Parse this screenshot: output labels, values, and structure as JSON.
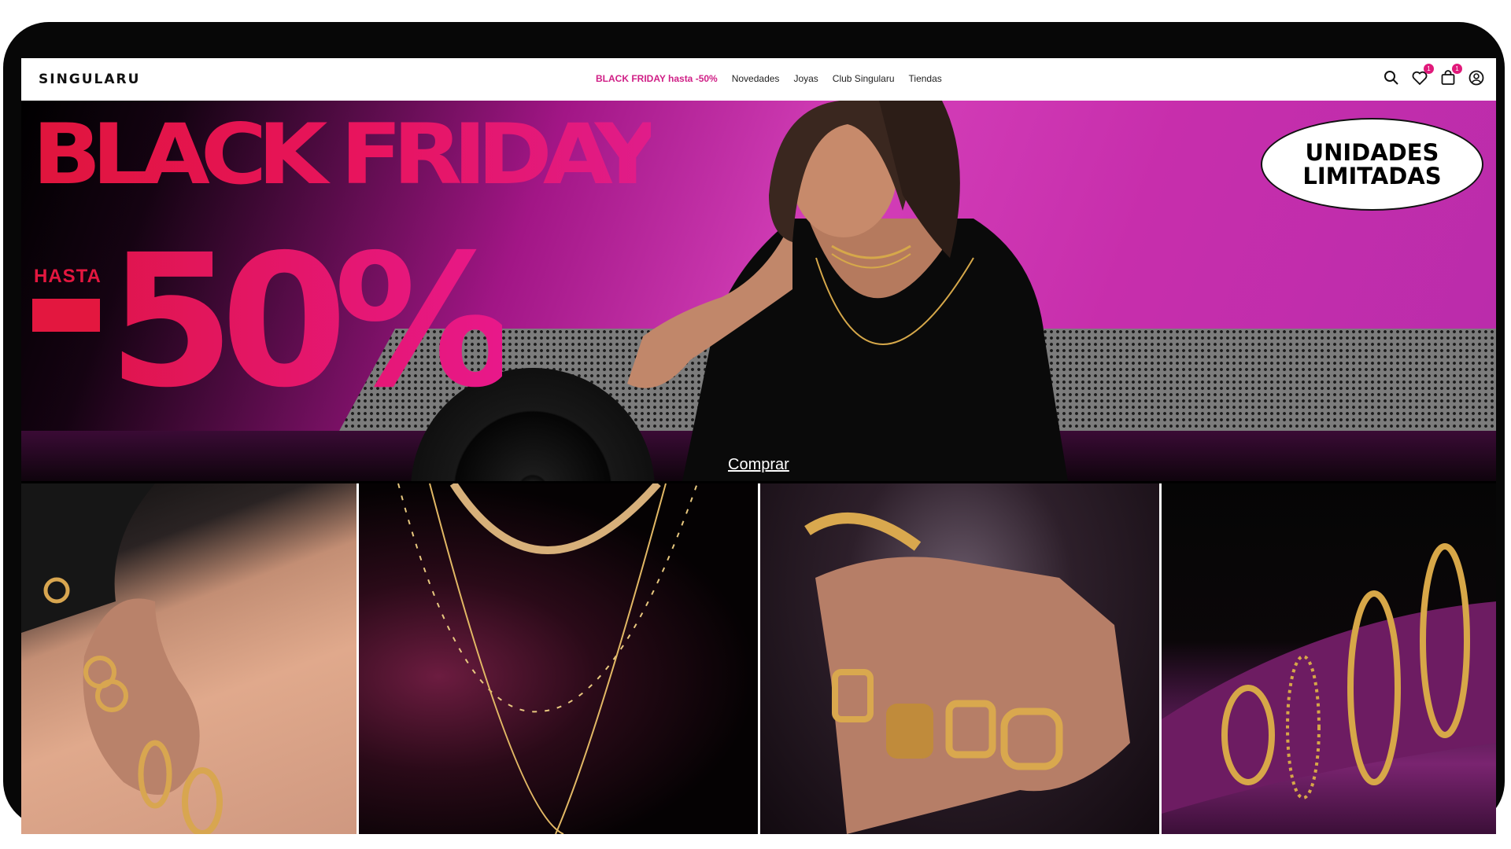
{
  "brand": {
    "logo_text": "SINGULARU",
    "accent_color": "#d01f86"
  },
  "nav": {
    "items": [
      {
        "label": "BLACK FRIDAY hasta -50%",
        "highlight": true
      },
      {
        "label": "Novedades"
      },
      {
        "label": "Joyas"
      },
      {
        "label": "Club Singularu"
      },
      {
        "label": "Tiendas"
      }
    ],
    "icons": [
      {
        "name": "search-icon"
      },
      {
        "name": "heart-icon",
        "badge": "1"
      },
      {
        "name": "cart-icon",
        "badge": "1"
      },
      {
        "name": "account-icon"
      }
    ]
  },
  "hero": {
    "title": "BLACK FRIDAY",
    "hasta": "HASTA",
    "discount": "50%",
    "badge_line1": "UNIDADES",
    "badge_line2": "LIMITADAS",
    "cta": "Comprar"
  },
  "tiles": [
    {
      "name": "earrings-tile"
    },
    {
      "name": "necklaces-tile"
    },
    {
      "name": "rings-tile"
    },
    {
      "name": "bracelets-tile"
    }
  ]
}
